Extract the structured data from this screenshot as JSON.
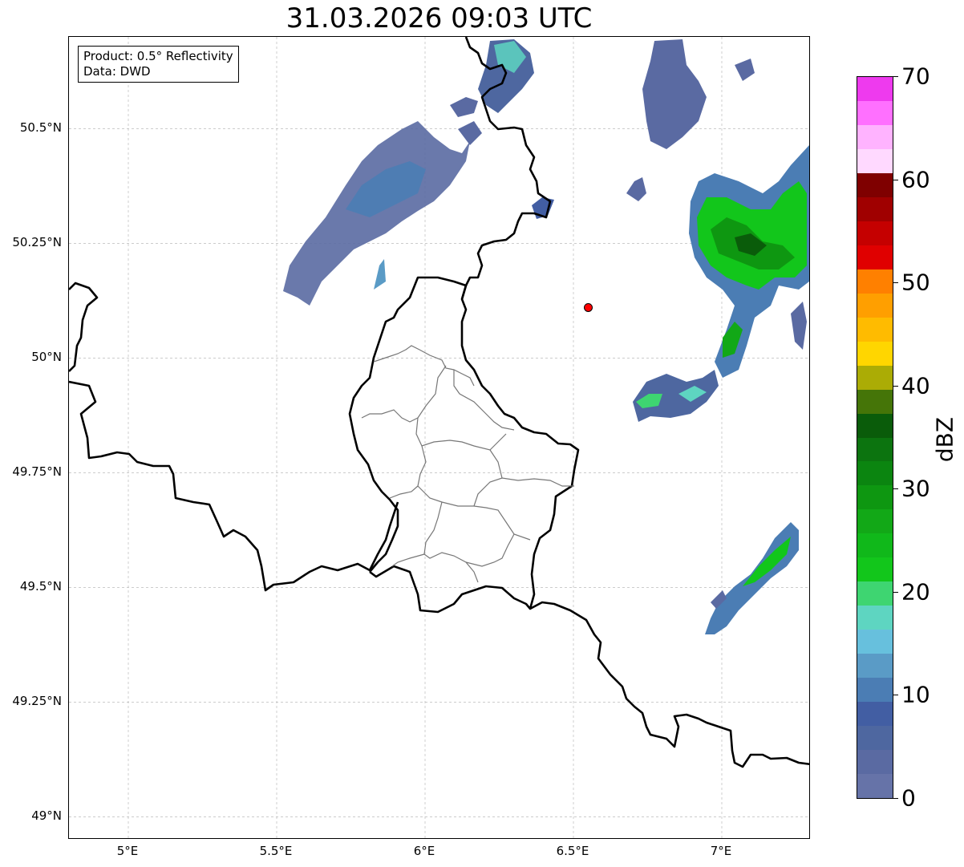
{
  "title": "31.03.2026 09:03 UTC",
  "info_box": {
    "line1": "Product: 0.5° Reflectivity",
    "line2": "Data: DWD"
  },
  "map": {
    "lon_range": [
      4.8,
      7.3
    ],
    "lat_range": [
      48.95,
      50.7
    ],
    "lat_ticks": [
      {
        "value": 50.5,
        "label": "50.5°N"
      },
      {
        "value": 50.25,
        "label": "50.25°N"
      },
      {
        "value": 50.0,
        "label": "50°N"
      },
      {
        "value": 49.75,
        "label": "49.75°N"
      },
      {
        "value": 49.5,
        "label": "49.5°N"
      },
      {
        "value": 49.25,
        "label": "49.25°N"
      },
      {
        "value": 49.0,
        "label": "49°N"
      }
    ],
    "lon_ticks": [
      {
        "value": 5.0,
        "label": "5°E"
      },
      {
        "value": 5.5,
        "label": "5.5°E"
      },
      {
        "value": 6.0,
        "label": "6°E"
      },
      {
        "value": 6.5,
        "label": "6.5°E"
      },
      {
        "value": 7.0,
        "label": "7°E"
      }
    ],
    "radar_site": {
      "lon": 6.55,
      "lat": 50.11,
      "color": "#ff0000"
    }
  },
  "colorbar": {
    "label": "dBZ",
    "min": 0,
    "max": 70,
    "ticks": [
      "0",
      "10",
      "20",
      "30",
      "40",
      "50",
      "60",
      "70"
    ],
    "colors": [
      "#6673a8",
      "#5a6aa2",
      "#4e67a0",
      "#425ea3",
      "#4b7db4",
      "#5a9bc6",
      "#67c0dd",
      "#5ed5c1",
      "#3ed571",
      "#12c61b",
      "#10b81a",
      "#12a817",
      "#0e9711",
      "#0b8510",
      "#0c740f",
      "#0a5c0a",
      "#457508",
      "#abac05",
      "#ffd600",
      "#ffbb00",
      "#ff9f00",
      "#ff8000",
      "#e00000",
      "#c50000",
      "#a00000",
      "#7f0000",
      "#ffd9ff",
      "#ffb3ff",
      "#ff70ff",
      "#ee3aee"
    ]
  }
}
